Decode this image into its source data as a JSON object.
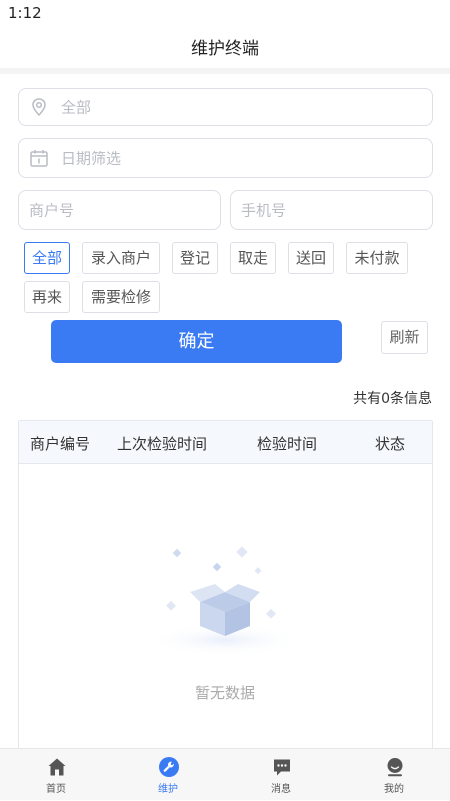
{
  "status_bar": {
    "time": "1:12"
  },
  "header": {
    "title": "维护终端"
  },
  "filters": {
    "location_placeholder": "全部",
    "date_placeholder": "日期筛选",
    "merchant_no_placeholder": "商户号",
    "phone_placeholder": "手机号",
    "chips": [
      "全部",
      "录入商户",
      "登记",
      "取走",
      "送回",
      "未付款",
      "再来",
      "需要检修"
    ],
    "active_chip": "全部"
  },
  "actions": {
    "confirm_label": "确定",
    "refresh_label": "刷新"
  },
  "summary": {
    "count_text": "共有0条信息"
  },
  "table": {
    "columns": [
      "商户编号",
      "上次检验时间",
      "检验时间",
      "状态"
    ],
    "rows": [],
    "empty_text": "暂无数据"
  },
  "tabbar": {
    "items": [
      {
        "label": "首页",
        "icon": "home-icon"
      },
      {
        "label": "维护",
        "icon": "wrench-icon"
      },
      {
        "label": "消息",
        "icon": "message-icon"
      },
      {
        "label": "我的",
        "icon": "user-icon"
      }
    ],
    "active_index": 1
  },
  "colors": {
    "accent": "#3a7bf3",
    "border": "#dcdfe6",
    "placeholder": "#b9bcc3"
  }
}
